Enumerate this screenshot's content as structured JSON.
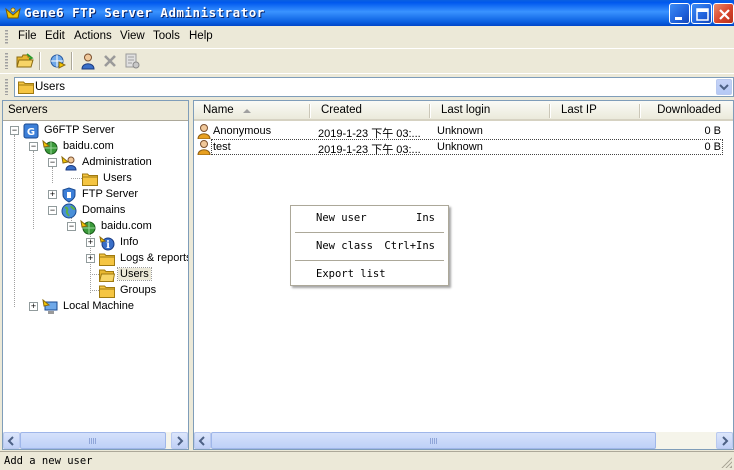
{
  "window": {
    "title": "Gene6 FTP Server Administrator"
  },
  "menubar": {
    "items": [
      "File",
      "Edit",
      "Actions",
      "View",
      "Tools",
      "Help"
    ]
  },
  "toolbar": {
    "buttons": [
      "open-folder-icon",
      "connect-icon",
      "user-icon",
      "delete-icon",
      "properties-icon"
    ]
  },
  "address": {
    "value": "Users"
  },
  "tree": {
    "header": "Servers",
    "nodes": [
      {
        "label": "G6FTP Server",
        "icon": "server-icon"
      },
      {
        "label": "baidu.com",
        "icon": "domain-icon"
      },
      {
        "label": "Administration",
        "icon": "admin-icon"
      },
      {
        "label": "Users",
        "icon": "folder-icon"
      },
      {
        "label": "FTP Server",
        "icon": "ftp-server-icon"
      },
      {
        "label": "Domains",
        "icon": "globe-icon"
      },
      {
        "label": "baidu.com",
        "icon": "domain-icon"
      },
      {
        "label": "Info",
        "icon": "info-icon"
      },
      {
        "label": "Logs & reports",
        "icon": "folder-icon"
      },
      {
        "label": "Users",
        "icon": "folder-icon"
      },
      {
        "label": "Groups",
        "icon": "folder-icon"
      },
      {
        "label": "Local Machine",
        "icon": "local-machine-icon"
      }
    ]
  },
  "list": {
    "columns": [
      "Name",
      "Created",
      "Last login",
      "Last IP",
      "Downloaded"
    ],
    "rows": [
      {
        "name": "Anonymous",
        "created": "2019-1-23 下午 03:...",
        "last_login": "Unknown",
        "last_ip": "",
        "downloaded": "0 B"
      },
      {
        "name": "test",
        "created": "2019-1-23 下午 03:...",
        "last_login": "Unknown",
        "last_ip": "",
        "downloaded": "0 B"
      }
    ]
  },
  "context_menu": {
    "items": [
      {
        "label": "New user",
        "shortcut": "Ins"
      },
      {
        "label": "New class",
        "shortcut": "Ctrl+Ins"
      },
      {
        "label": "Export list",
        "shortcut": ""
      }
    ]
  },
  "status": {
    "text": "Add a new user"
  },
  "colors": {
    "titlebar": "#0a5fe0",
    "selection_bg": "#ece9d8",
    "folder": "#f5c542"
  }
}
